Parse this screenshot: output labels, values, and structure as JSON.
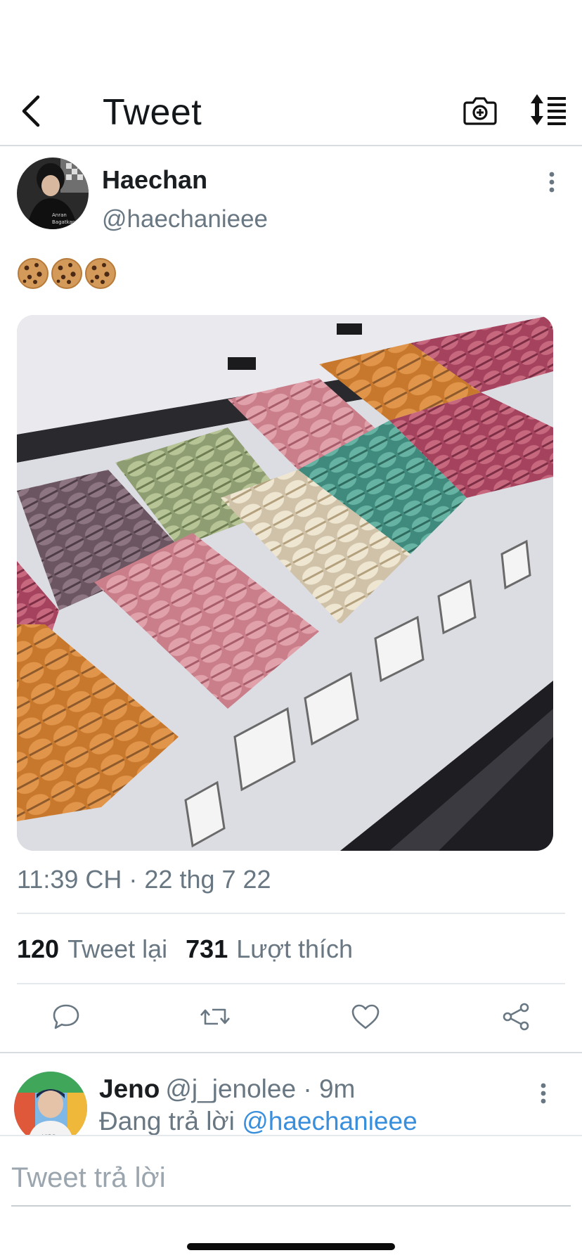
{
  "nav": {
    "title": "Tweet",
    "back_icon": "chevron-left-icon",
    "camera_icon": "camera-plus-icon",
    "sort_icon": "sort-list-icon"
  },
  "tweet": {
    "author": {
      "display_name": "Haechan",
      "handle": "@haechanieee"
    },
    "text_emojis": [
      "cookie",
      "cookie",
      "cookie"
    ],
    "media_description": "macarons",
    "timestamp": "11:39 CH · 22 thg 7 22",
    "stats": {
      "retweets_count": "120",
      "retweets_label": "Tweet lại",
      "likes_count": "731",
      "likes_label": "Lượt thích"
    },
    "actions": [
      "reply-icon",
      "retweet-icon",
      "like-icon",
      "share-icon"
    ]
  },
  "reply": {
    "display_name": "Jeno",
    "handle": "@j_jenolee",
    "separator": "·",
    "time": "9m",
    "replying_prefix": "Đang trả lời",
    "replying_to": "@haechanieee"
  },
  "compose": {
    "placeholder": "Tweet trả lời"
  },
  "colors": {
    "accent": "#3a8fdc",
    "secondary_text": "#687782",
    "divider": "#e6e9eb"
  }
}
